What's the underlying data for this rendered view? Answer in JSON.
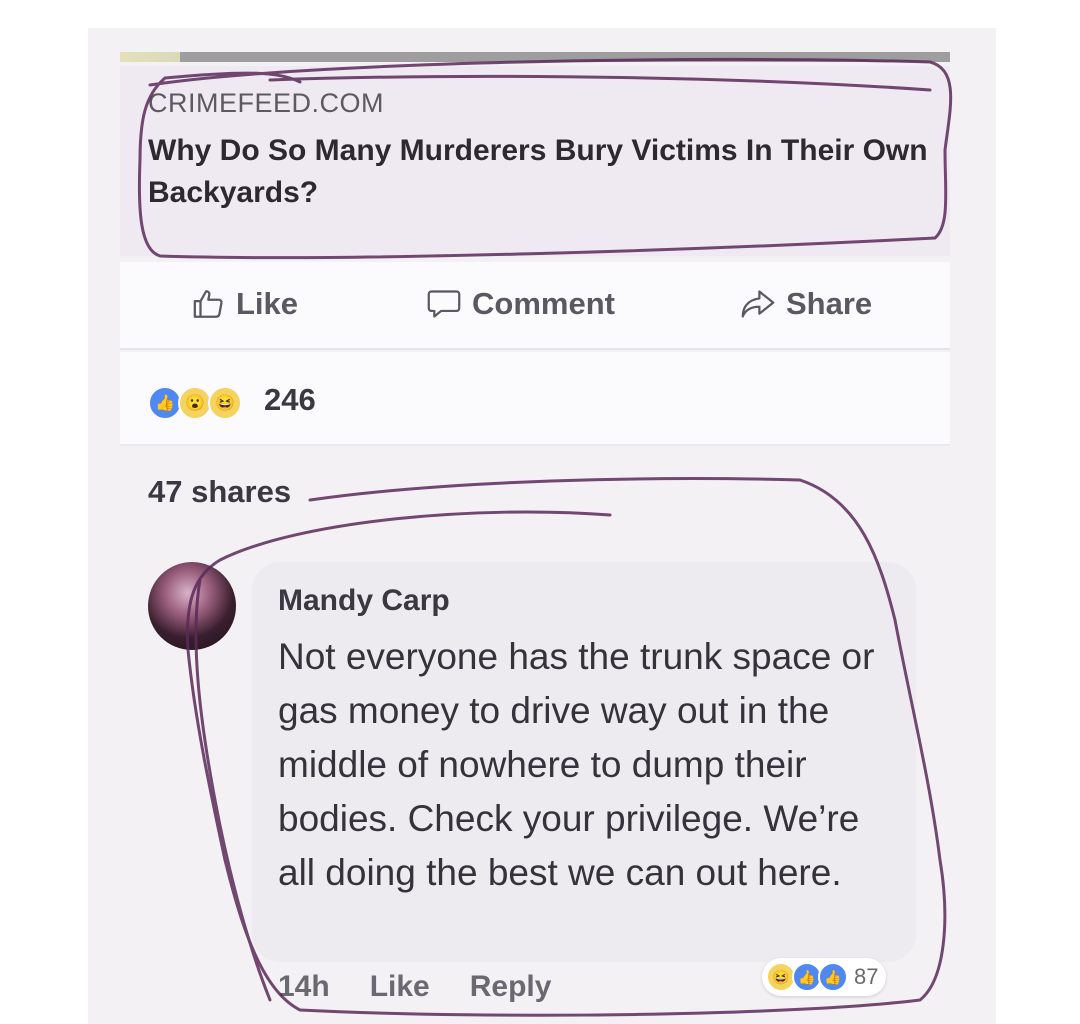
{
  "link_preview": {
    "source": "CRIMEFEED.COM",
    "title": "Why Do So Many Murderers Bury Victims In Their Own Backyards?"
  },
  "actions": {
    "like_label": "Like",
    "comment_label": "Comment",
    "share_label": "Share"
  },
  "reactions": {
    "count": "246",
    "icons": [
      "like-icon",
      "wow-icon",
      "haha-icon"
    ]
  },
  "shares": "47 shares",
  "comment": {
    "author": "Mandy Carp",
    "text": "Not everyone has the trunk space or gas money to drive way out in the middle of nowhere to dump their bodies. Check your privilege. We’re all doing the best we can out here.",
    "time": "14h",
    "like_label": "Like",
    "reply_label": "Reply",
    "reaction_count": "87",
    "reaction_icons": [
      "haha-icon",
      "like-icon",
      "like-icon"
    ]
  },
  "colors": {
    "marker": "#5b2a5a",
    "like_blue": "#4e88f0",
    "emoji_yellow": "#f4d35e"
  }
}
